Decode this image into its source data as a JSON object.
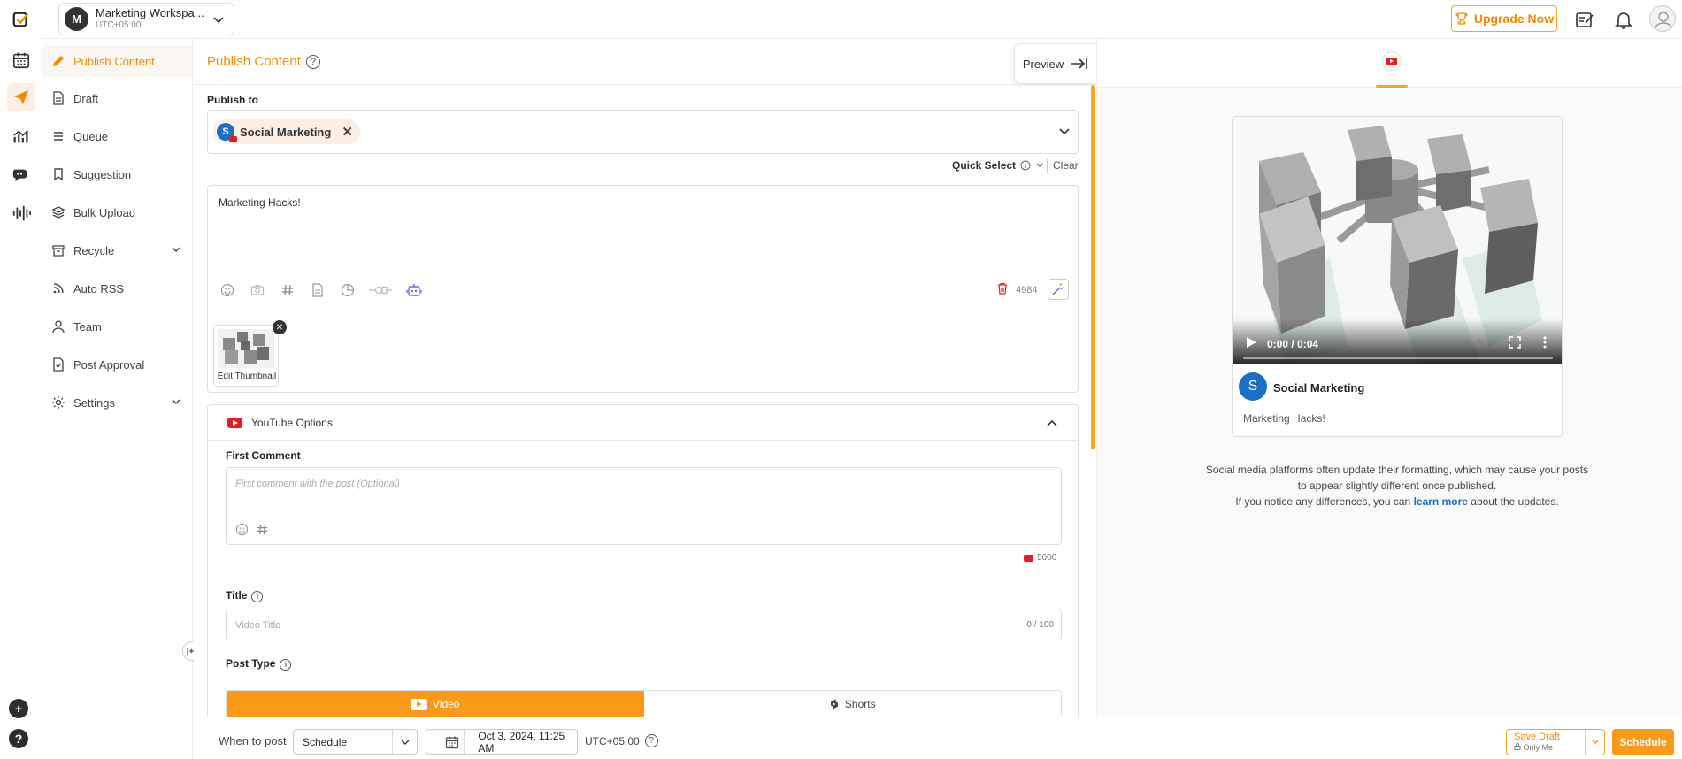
{
  "topbar": {
    "workspace_avatar": "M",
    "workspace_name": "Marketing Workspa...",
    "workspace_timezone": "UTC+05:00",
    "upgrade_label": "Upgrade Now"
  },
  "subnav": {
    "items": [
      {
        "label": "Publish Content",
        "icon": "pen-icon"
      },
      {
        "label": "Draft",
        "icon": "document-icon"
      },
      {
        "label": "Queue",
        "icon": "list-icon"
      },
      {
        "label": "Suggestion",
        "icon": "bookmark-icon"
      },
      {
        "label": "Bulk Upload",
        "icon": "layers-icon"
      },
      {
        "label": "Recycle",
        "icon": "archive-icon"
      },
      {
        "label": "Auto RSS",
        "icon": "rss-icon"
      },
      {
        "label": "Team",
        "icon": "user-icon"
      },
      {
        "label": "Post Approval",
        "icon": "document-check-icon"
      },
      {
        "label": "Settings",
        "icon": "gear-icon"
      }
    ]
  },
  "editor": {
    "title": "Publish Content",
    "help": "?",
    "preview_label": "Preview",
    "publish_to_label": "Publish to",
    "selected_account": {
      "initial": "S",
      "name": "Social Marketing"
    },
    "quick_select_label": "Quick Select",
    "clear_label": "Clear",
    "post_text": "Marketing Hacks!",
    "char_remaining": "4984",
    "thumbnail_label": "Edit Thumbnail"
  },
  "youtube_options": {
    "header": "YouTube Options",
    "first_comment_label": "First Comment",
    "first_comment_placeholder": "First comment with the post (Optional)",
    "first_comment_limit": "5000",
    "title_label": "Title",
    "title_placeholder": "Video Title",
    "title_count": "0 / 100",
    "post_type_label": "Post Type",
    "post_types": [
      {
        "label": "Video",
        "active": true
      },
      {
        "label": "Shorts",
        "active": false
      }
    ]
  },
  "bottombar": {
    "when_label": "When to post",
    "schedule_option": "Schedule",
    "datetime": "Oct 3, 2024, 11:25 AM",
    "timezone": "UTC+05:00",
    "save_draft_label": "Save Draft",
    "save_draft_scope": "Only Me",
    "schedule_button": "Schedule"
  },
  "preview": {
    "video_time": "0:00 / 0:04",
    "account_initial": "S",
    "account_name": "Social Marketing",
    "post_text": "Marketing Hacks!",
    "note_line1": "Social media platforms often update their formatting, which may cause your posts",
    "note_line2": "to appear slightly different once published.",
    "note_line3_pre": "If you notice any differences, you can",
    "note_link": "learn more",
    "note_line3_post": "about the updates."
  },
  "colors": {
    "accent": "#f99a1a",
    "accent_text": "#f08c00",
    "youtube_red": "#e02020",
    "link_blue": "#1b6fc5"
  }
}
